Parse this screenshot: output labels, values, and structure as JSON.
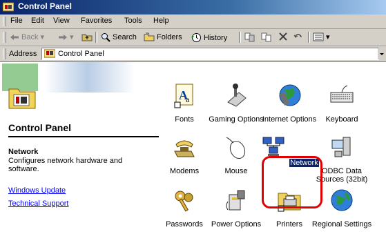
{
  "window": {
    "title": "Control Panel"
  },
  "menu": [
    "File",
    "Edit",
    "View",
    "Favorites",
    "Tools",
    "Help"
  ],
  "toolbar": {
    "back": "Back",
    "search": "Search",
    "folders": "Folders",
    "history": "History"
  },
  "address": {
    "label": "Address",
    "value": "Control Panel"
  },
  "panel": {
    "title": "Control Panel",
    "selected_name": "Network",
    "selected_desc": "Configures network hardware and software.",
    "links": [
      "Windows Update",
      "Technical Support"
    ]
  },
  "items": [
    {
      "label": "Fonts",
      "icon": "fonts-icon"
    },
    {
      "label": "Gaming Options",
      "icon": "gaming-options-icon"
    },
    {
      "label": "Internet Options",
      "icon": "internet-options-icon"
    },
    {
      "label": "Keyboard",
      "icon": "keyboard-icon"
    },
    {
      "label": "Modems",
      "icon": "modems-icon"
    },
    {
      "label": "Mouse",
      "icon": "mouse-icon"
    },
    {
      "label": "Network",
      "icon": "network-icon",
      "selected": true
    },
    {
      "label": "ODBC Data Sources (32bit)",
      "icon": "odbc-icon"
    },
    {
      "label": "Passwords",
      "icon": "passwords-icon"
    },
    {
      "label": "Power Options",
      "icon": "power-options-icon"
    },
    {
      "label": "Printers",
      "icon": "printers-icon"
    },
    {
      "label": "Regional Settings",
      "icon": "regional-settings-icon"
    }
  ],
  "colors": {
    "title_bar": "#0a246a",
    "selection": "#0a246a",
    "highlight_ring": "#e00000",
    "link": "#0000ff"
  }
}
